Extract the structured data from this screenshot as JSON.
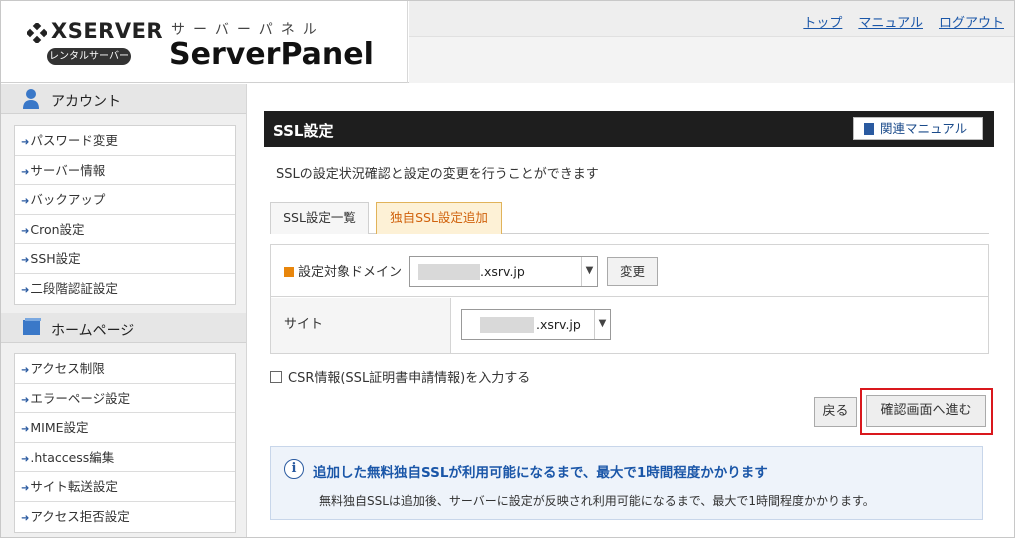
{
  "header": {
    "brand": "XSERVER",
    "brand_sub": "レンタルサーバー",
    "kana": "サーバーパネル",
    "product": "ServerPanel",
    "links": [
      "トップ",
      "マニュアル",
      "ログアウト"
    ]
  },
  "sidebar": {
    "account_title": "アカウント",
    "account_items": [
      "パスワード変更",
      "サーバー情報",
      "バックアップ",
      "Cron設定",
      "SSH設定",
      "二段階認証設定"
    ],
    "homepage_title": "ホームページ",
    "homepage_items": [
      "アクセス制限",
      "エラーページ設定",
      "MIME設定",
      ".htaccess編集",
      "サイト転送設定",
      "アクセス拒否設定"
    ]
  },
  "main": {
    "title": "SSL設定",
    "manual_button": "関連マニュアル",
    "description": "SSLの設定状況確認と設定の変更を行うことができます",
    "tabs": [
      "SSL設定一覧",
      "独自SSL設定追加"
    ],
    "domain_label": "設定対象ドメイン",
    "domain_value": ".xsrv.jp",
    "change_button": "変更",
    "site_label": "サイト",
    "site_value": ".xsrv.jp",
    "csr_label": "CSR情報(SSL証明書申請情報)を入力する",
    "back_button": "戻る",
    "next_button": "確認画面へ進む",
    "info_heading": "追加した無料独自SSLが利用可能になるまで、最大で1時間程度かかります",
    "info_body": "無料独自SSLは追加後、サーバーに設定が反映され利用可能になるまで、最大で1時間程度かかります。"
  }
}
